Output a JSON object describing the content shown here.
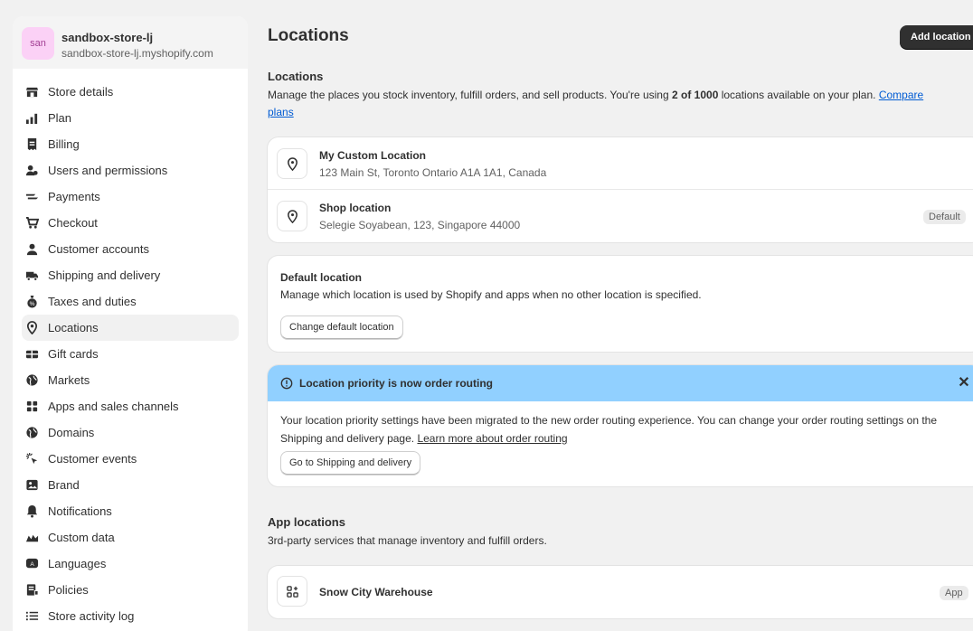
{
  "store": {
    "avatar_text": "san",
    "name": "sandbox-store-lj",
    "domain": "sandbox-store-lj.myshopify.com"
  },
  "sidebar": {
    "items": [
      {
        "label": "Store details",
        "icon": "store-icon"
      },
      {
        "label": "Plan",
        "icon": "plan-icon"
      },
      {
        "label": "Billing",
        "icon": "billing-icon"
      },
      {
        "label": "Users and permissions",
        "icon": "users-icon"
      },
      {
        "label": "Payments",
        "icon": "payments-icon"
      },
      {
        "label": "Checkout",
        "icon": "cart-icon"
      },
      {
        "label": "Customer accounts",
        "icon": "person-icon"
      },
      {
        "label": "Shipping and delivery",
        "icon": "truck-icon"
      },
      {
        "label": "Taxes and duties",
        "icon": "taxes-icon"
      },
      {
        "label": "Locations",
        "icon": "location-icon",
        "active": true
      },
      {
        "label": "Gift cards",
        "icon": "gift-card-icon"
      },
      {
        "label": "Markets",
        "icon": "globe-icon"
      },
      {
        "label": "Apps and sales channels",
        "icon": "apps-icon"
      },
      {
        "label": "Domains",
        "icon": "globe-icon"
      },
      {
        "label": "Customer events",
        "icon": "cursor-icon"
      },
      {
        "label": "Brand",
        "icon": "brand-icon"
      },
      {
        "label": "Notifications",
        "icon": "bell-icon"
      },
      {
        "label": "Custom data",
        "icon": "custom-data-icon"
      },
      {
        "label": "Languages",
        "icon": "language-icon"
      },
      {
        "label": "Policies",
        "icon": "policies-icon"
      },
      {
        "label": "Store activity log",
        "icon": "list-icon"
      }
    ]
  },
  "page": {
    "title": "Locations",
    "add_button": "Add location"
  },
  "locations_section": {
    "heading": "Locations",
    "desc_prefix": "Manage the places you stock inventory, fulfill orders, and sell products. You're using ",
    "desc_bold": "2 of 1000",
    "desc_suffix": " locations available on your plan. ",
    "desc_link_1": "Compare",
    "desc_link_2": "plans",
    "items": [
      {
        "name": "My Custom Location",
        "address": "123 Main St, Toronto Ontario A1A 1A1, Canada",
        "badge": ""
      },
      {
        "name": "Shop location",
        "address": "Selegie Soyabean, 123, Singapore 44000",
        "badge": "Default"
      }
    ]
  },
  "default_location": {
    "title": "Default location",
    "text": "Manage which location is used by Shopify and apps when no other location is specified.",
    "button": "Change default location"
  },
  "banner": {
    "title": "Location priority is now order routing",
    "text": "Your location priority settings have been migrated to the new order routing experience. You can change your order routing settings on the Shipping and delivery page. ",
    "link": "Learn more about order routing",
    "button": "Go to Shipping and delivery",
    "info_color": "#91d0ff"
  },
  "app_locations": {
    "heading": "App locations",
    "desc": "3rd-party services that manage inventory and fulfill orders.",
    "items": [
      {
        "name": "Snow City Warehouse",
        "badge": "App"
      }
    ]
  }
}
